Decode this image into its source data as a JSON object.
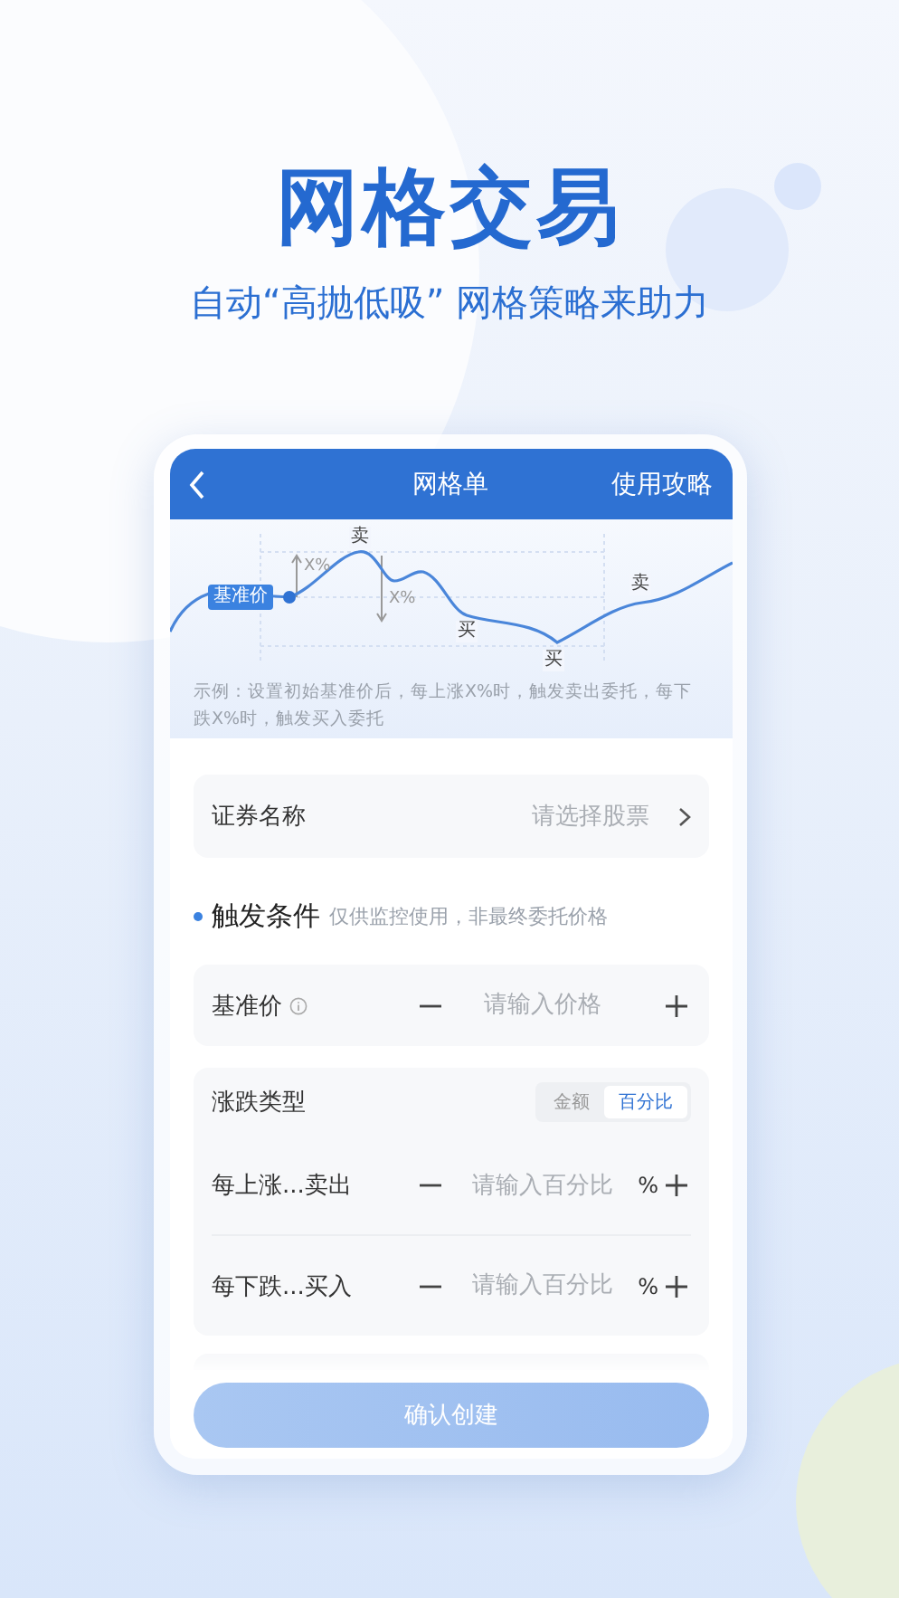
{
  "headline": "网格交易",
  "subheadline": "自动“高抛低吸” 网格策略来助力",
  "screen": {
    "nav": {
      "title": "网格单",
      "action": "使用攻略"
    },
    "illustration": {
      "base_label": "基准价",
      "markers": [
        "卖",
        "X%",
        "X%",
        "买",
        "买",
        "卖"
      ],
      "example": "示例：设置初始基准价后，每上涨X%时，触发卖出委托，每下跌X%时，触发买入委托"
    },
    "security": {
      "label": "证券名称",
      "placeholder": "请选择股票"
    },
    "section": {
      "title": "触发条件",
      "note": "仅供监控使用，非最终委托价格"
    },
    "base_price": {
      "label": "基准价",
      "placeholder": "请输入价格"
    },
    "change_type": {
      "label": "涨跌类型",
      "options": [
        {
          "label": "金额",
          "selected": false
        },
        {
          "label": "百分比",
          "selected": true
        }
      ],
      "rows": [
        {
          "label": "每上涨...卖出",
          "placeholder": "请输入百分比",
          "unit": "%"
        },
        {
          "label": "每下跌...买入",
          "placeholder": "请输入百分比",
          "unit": "%"
        }
      ]
    },
    "confirm": {
      "label": "确认创建",
      "disabled": true
    }
  }
}
